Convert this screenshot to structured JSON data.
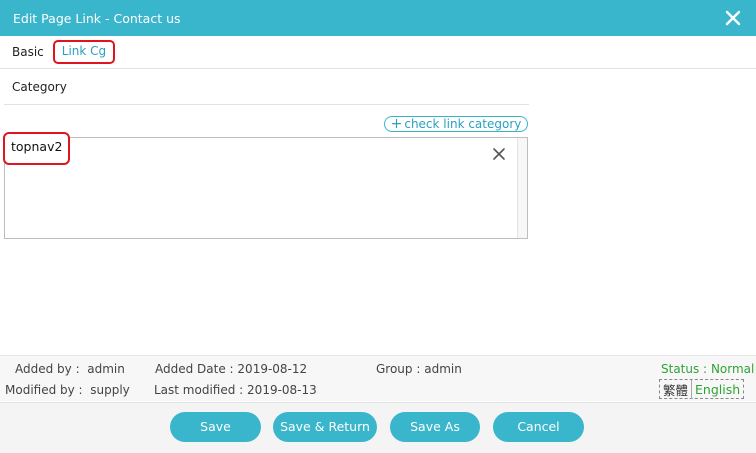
{
  "dialog": {
    "title": "Edit Page Link - Contact us",
    "close_icon": "close-icon"
  },
  "tabs": [
    {
      "label": "Basic",
      "active": false
    },
    {
      "label": "Link Cg",
      "active": true
    }
  ],
  "category": {
    "section_title": "Category",
    "check_link_label": "check link category",
    "check_link_icon": "plus-icon",
    "items": [
      {
        "label": "topnav2",
        "remove_icon": "remove-x-icon"
      }
    ]
  },
  "info": {
    "added_by_label": "Added by :",
    "added_by_value": "admin",
    "added_date_label": "Added Date :",
    "added_date_value": "2019-08-12",
    "group_label": "Group :",
    "group_value": "admin",
    "status_label": "Status :",
    "status_value": "Normal",
    "modified_by_label": "Modified by :",
    "modified_by_value": "supply",
    "last_modified_label": "Last modified :",
    "last_modified_value": "2019-08-13",
    "lang_tc": "繁體",
    "lang_en": "English"
  },
  "buttons": {
    "save": "Save",
    "save_return": "Save & Return",
    "save_as": "Save As",
    "cancel": "Cancel"
  },
  "colors": {
    "accent": "#3ab6cc",
    "highlight": "#e0141e",
    "status": "#2ea335"
  }
}
